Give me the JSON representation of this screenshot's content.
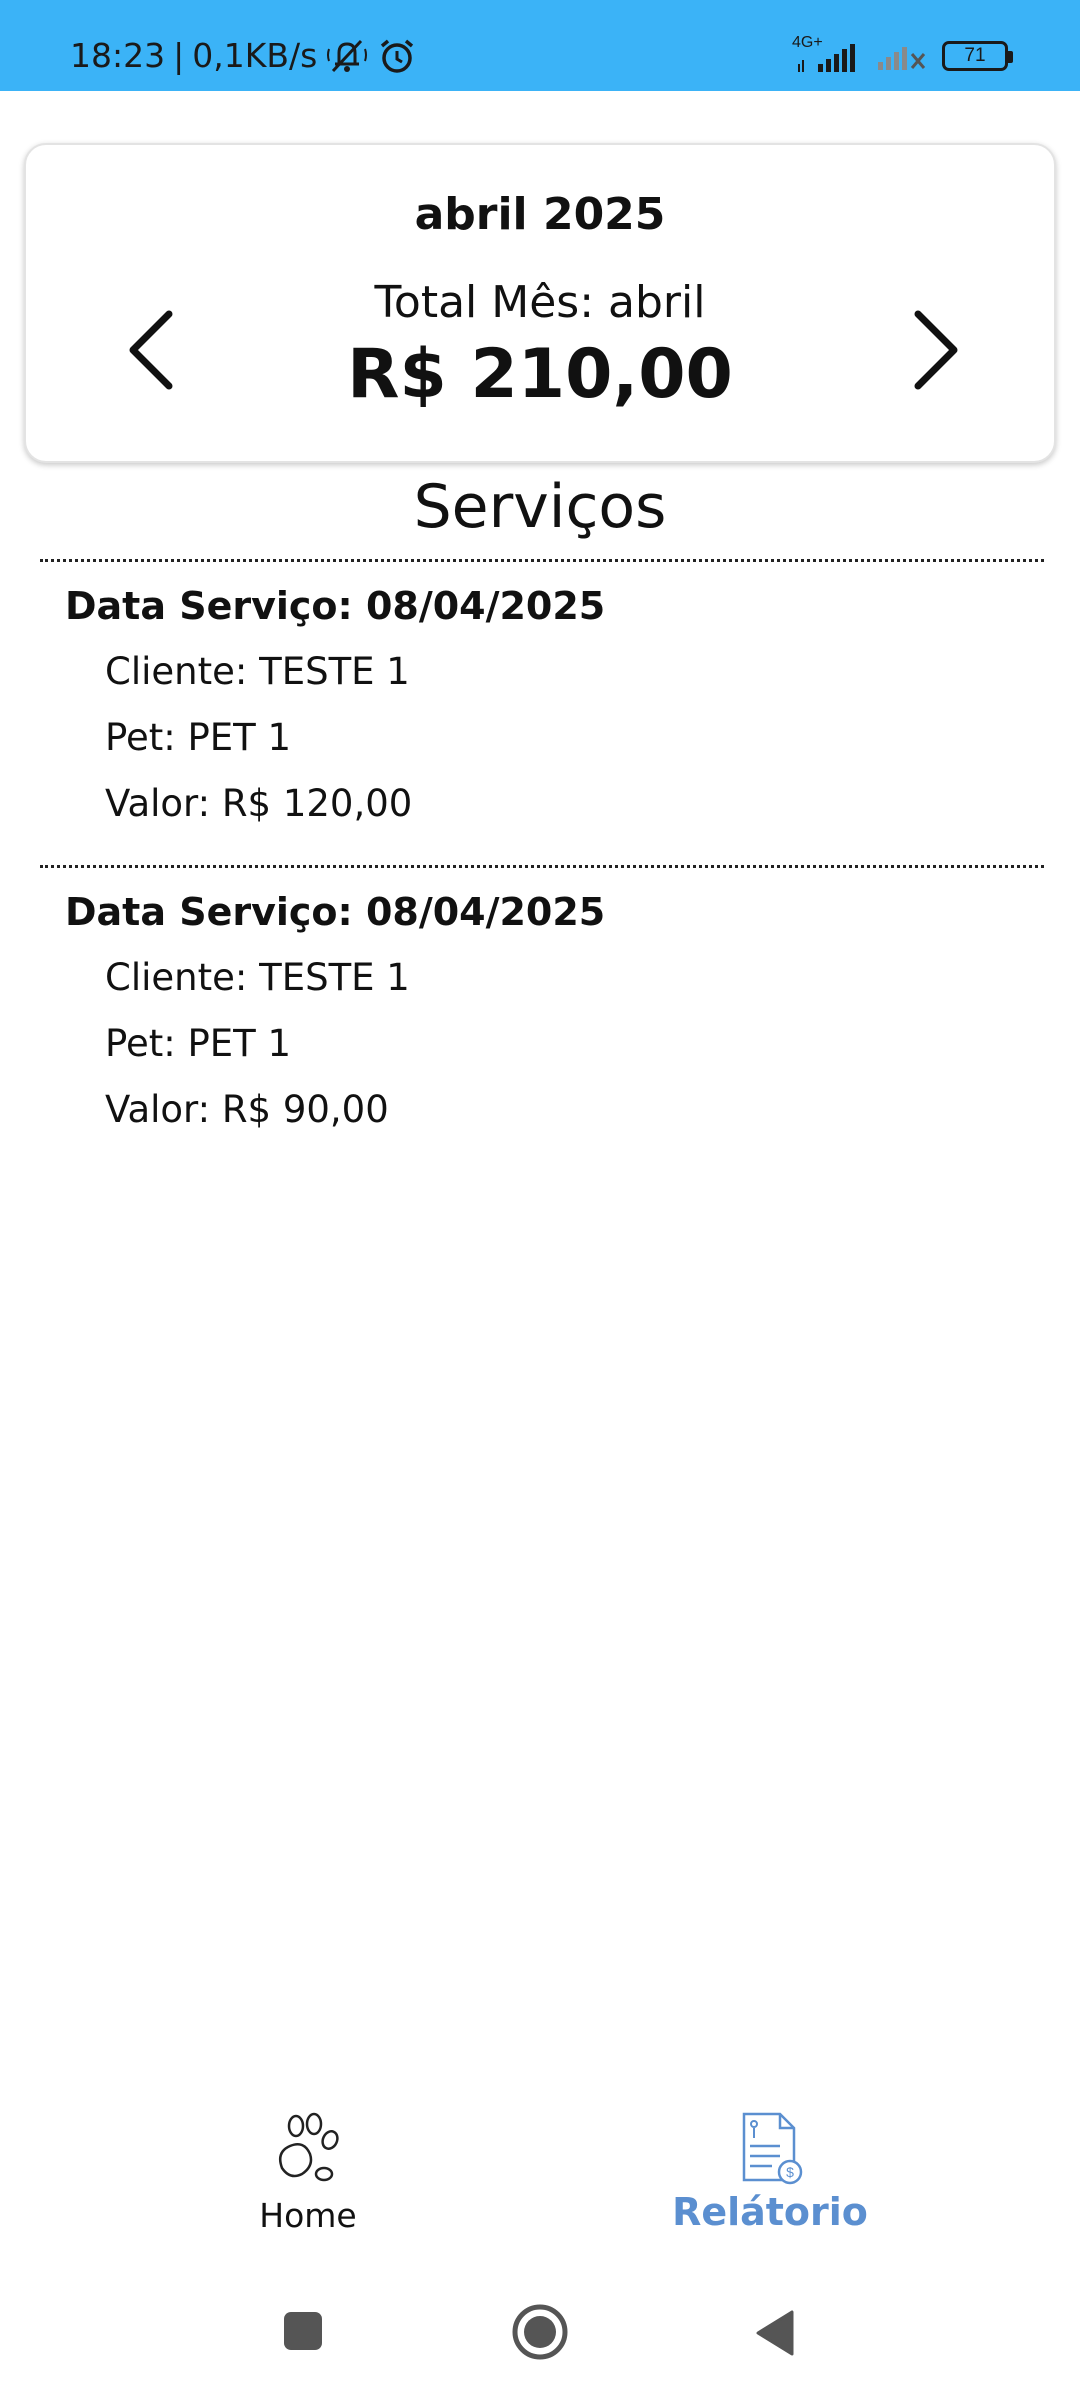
{
  "status_bar": {
    "time": "18:23",
    "speed": "0,1KB/s",
    "network_type": "4G+",
    "battery": "71",
    "icons": [
      "bell-off-icon",
      "alarm-icon",
      "signal-icon",
      "signal-x-icon",
      "battery-icon"
    ]
  },
  "month_card": {
    "month_year": "abril 2025",
    "total_label": "Total Mês: abril",
    "total_value": "R$ 210,00"
  },
  "services": {
    "title": "Serviços",
    "items": [
      {
        "date": "Data Serviço: 08/04/2025",
        "client": "Cliente: TESTE 1",
        "pet": "Pet: PET 1",
        "value": "Valor: R$ 120,00"
      },
      {
        "date": "Data Serviço: 08/04/2025",
        "client": "Cliente: TESTE 1",
        "pet": "Pet: PET 1",
        "value": "Valor: R$ 90,00"
      }
    ]
  },
  "bottom_nav": {
    "home_label": "Home",
    "report_label": "Relátorio",
    "active_color": "#5b8fd0"
  },
  "colors": {
    "status_bar": "#3bb3f7",
    "accent": "#5b8fd0"
  }
}
